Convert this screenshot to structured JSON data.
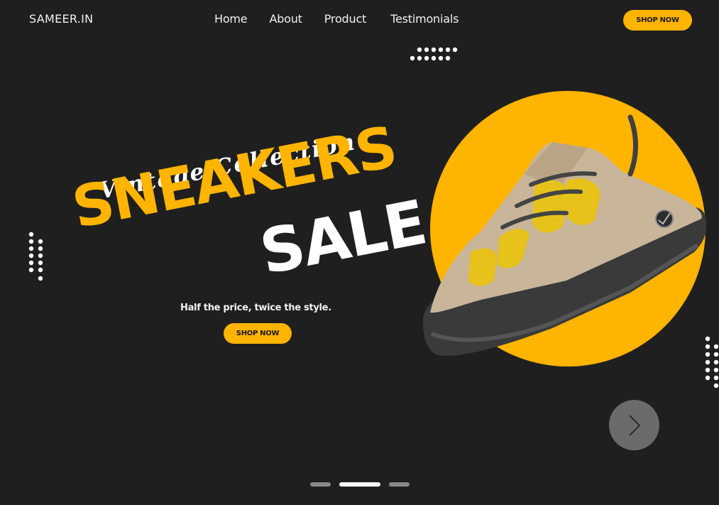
{
  "brand": {
    "logo": "SAMEER.IN"
  },
  "nav": {
    "items": [
      {
        "label": "Home"
      },
      {
        "label": "About"
      },
      {
        "label": "Product"
      },
      {
        "label": "Testimonials"
      }
    ],
    "cta_label": "SHOP NOW"
  },
  "hero": {
    "script_line": "Vintage Collection",
    "headline_1": "SNEAKERS",
    "headline_2": "SALE",
    "tagline": "Half the price, twice the style.",
    "cta_label": "SHOP NOW"
  },
  "carousel": {
    "next_icon": "chevron-right-icon",
    "slide_count": 3,
    "active_slide": 2
  },
  "colors": {
    "background": "#1f1f20",
    "accent": "#ffb400",
    "text": "#ffffff",
    "arrow_button": "#6b6b6b"
  }
}
